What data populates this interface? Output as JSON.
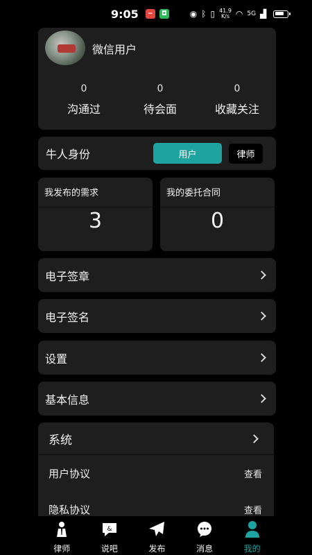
{
  "status_bar": {
    "time": "9:05",
    "speed_top": "41.9",
    "speed_bottom": "K/s",
    "network": "5G"
  },
  "profile": {
    "username": "微信用户",
    "stats": [
      {
        "value": "0",
        "label": "沟通过"
      },
      {
        "value": "0",
        "label": "待会面"
      },
      {
        "value": "0",
        "label": "收藏关注"
      }
    ]
  },
  "role": {
    "title": "牛人身份",
    "user_label": "用户",
    "lawyer_label": "律师",
    "accent": "#1fa3a0"
  },
  "summary": [
    {
      "title": "我发布的需求",
      "value": "3"
    },
    {
      "title": "我的委托合同",
      "value": "0"
    }
  ],
  "menu": [
    {
      "label": "电子签章"
    },
    {
      "label": "电子签名"
    },
    {
      "label": "设置"
    },
    {
      "label": "基本信息"
    }
  ],
  "system": {
    "title": "系统",
    "rows": [
      {
        "label": "用户协议",
        "action": "查看"
      },
      {
        "label": "隐私协议",
        "action": "查看"
      }
    ]
  },
  "tabs": [
    {
      "label": "律师",
      "icon": "lawyer-icon"
    },
    {
      "label": "说吧",
      "icon": "chat-bubble-icon"
    },
    {
      "label": "发布",
      "icon": "plane-icon"
    },
    {
      "label": "消息",
      "icon": "message-icon"
    },
    {
      "label": "我的",
      "icon": "person-icon",
      "active": true
    }
  ]
}
